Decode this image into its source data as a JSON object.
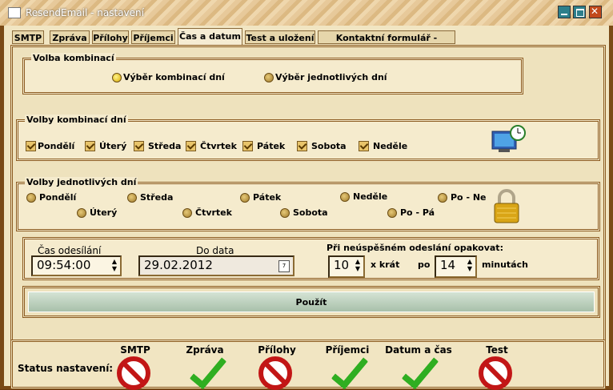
{
  "window": {
    "title": "ResendEmail - nastavení"
  },
  "tabs": [
    "SMTP",
    "Zpráva",
    "Přílohy",
    "Příjemci",
    "Čas a datum",
    "Test a uložení",
    "Kontaktní formulář - podpora"
  ],
  "volba_kombinaci": {
    "legend": "Volba kombinací",
    "option1": "Výběr kombinací dní",
    "option2": "Výběr jednotlivých dní"
  },
  "volby_kombinaci_dni": {
    "legend": "Volby kombinací dní",
    "days": [
      "Pondělí",
      "Úterý",
      "Středa",
      "Čtvrtek",
      "Pátek",
      "Sobota",
      "Neděle"
    ]
  },
  "volby_jednotlivych_dni": {
    "legend": "Volby jednotlivých dní",
    "row1": [
      "Pondělí",
      "Středa",
      "Pátek",
      "Neděle",
      "Po - Ne"
    ],
    "row2": [
      "Úterý",
      "Čtvrtek",
      "Sobota",
      "Po - Pá"
    ]
  },
  "cas": {
    "label": "Čas odesílání",
    "value": "09:54:00"
  },
  "datum": {
    "label": "Do data",
    "value": "29.02.2012",
    "calendar_day": "7"
  },
  "opakovat": {
    "label": "Při neúspěšném odeslání opakovat:",
    "count": "10",
    "count_suffix": "x krát",
    "po": "po",
    "interval": "14",
    "interval_suffix": "minutách"
  },
  "apply_button": "Použít",
  "status": {
    "label": "Status nastavení:",
    "items": [
      {
        "name": "SMTP",
        "ok": false
      },
      {
        "name": "Zpráva",
        "ok": true
      },
      {
        "name": "Přílohy",
        "ok": false
      },
      {
        "name": "Příjemci",
        "ok": true
      },
      {
        "name": "Datum a čas",
        "ok": true
      },
      {
        "name": "Test",
        "ok": false
      }
    ]
  },
  "colors": {
    "ok": "#2fae21",
    "error": "#c21616",
    "frame": "#8b5a20"
  },
  "icons": {
    "computer": "computer-clock-icon",
    "lock": "padlock-icon"
  }
}
